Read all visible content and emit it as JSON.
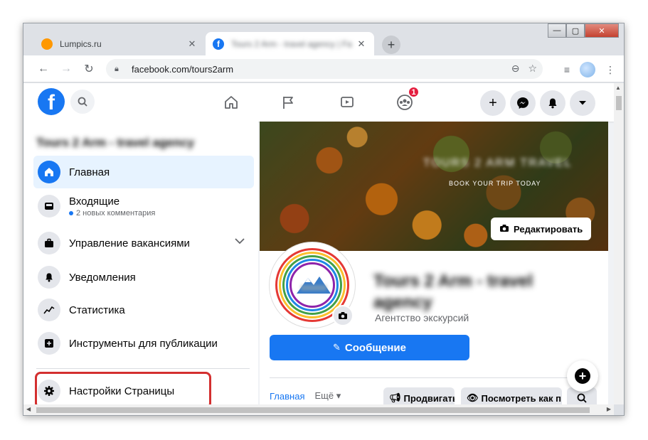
{
  "browser": {
    "tabs": [
      {
        "title": "Lumpics.ru",
        "favicon": "orange-favicon",
        "active": false
      },
      {
        "title": "Tours 2 Arm - travel agency | Fa",
        "favicon": "facebook-favicon",
        "active": true
      }
    ],
    "url": "facebook.com/tours2arm",
    "window_controls": {
      "minimize": "—",
      "maximize": "▢",
      "close": "✕"
    }
  },
  "fb": {
    "logo": "f",
    "notif_count": "1"
  },
  "sidebar": {
    "page_name": "Tours 2 Arm - travel agency",
    "items": [
      {
        "label": "Главная",
        "icon": "home-icon",
        "active": true
      },
      {
        "label": "Входящие",
        "sub": "2 новых комментария",
        "icon": "inbox-icon"
      },
      {
        "label": "Управление вакансиями",
        "icon": "briefcase-icon"
      },
      {
        "label": "Уведомления",
        "icon": "bell-icon"
      },
      {
        "label": "Статистика",
        "icon": "stats-icon"
      },
      {
        "label": "Инструменты для публикации",
        "icon": "publishing-tools-icon"
      },
      {
        "label": "Настройки Страницы",
        "icon": "gear-icon"
      }
    ]
  },
  "cover": {
    "blurred_text": "TOURS 2 ARM TRAVEL",
    "tagline": "BOOK YOUR TRIP TODAY",
    "edit_label": "Редактировать"
  },
  "profile": {
    "title": "Tours 2 Arm - travel agency",
    "category": "Агентство экскурсий",
    "message_label": "Сообщение",
    "tabs": [
      "Главная",
      "Ещё ▾"
    ],
    "promote_label": "Продвигать",
    "view_as_label": "Посмотреть как п"
  },
  "colors": {
    "fb_blue": "#1877f2",
    "highlight_red": "#d32f2f",
    "badge_red": "#e41e3f"
  }
}
